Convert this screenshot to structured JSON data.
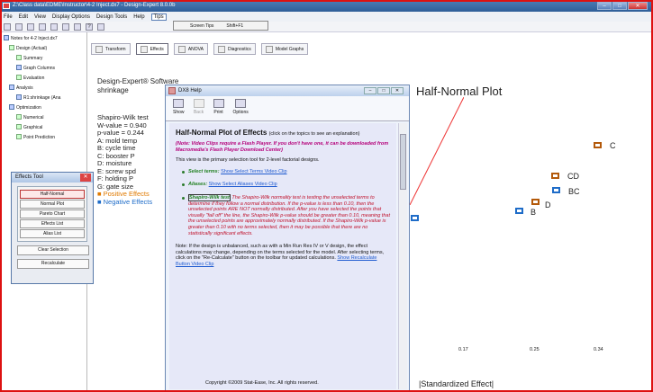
{
  "window": {
    "title": "Z:\\Class data\\EDME\\Instructor\\4-2 Inject.dx7 - Design-Expert 8.0.0b"
  },
  "menu": {
    "items": [
      "File",
      "Edit",
      "View",
      "Display Options",
      "Design Tools",
      "Help",
      "Tips"
    ],
    "tips_items": [
      "Screen Tips",
      "Shift+F1"
    ]
  },
  "tree": {
    "nodes": [
      "Notes for 4-2 Inject.dx7",
      "Design (Actual)",
      "Summary",
      "Graph Columns",
      "Evaluation",
      "Analysis",
      "R1:shrinkage (Ana",
      "Optimization",
      "Numerical",
      "Graphical",
      "Point Prediction"
    ]
  },
  "tabs": [
    "Transform",
    "Effects",
    "ANOVA",
    "Diagnostics",
    "Model Graphs"
  ],
  "content": {
    "software": "Design-Expert® Software",
    "response": "shrinkage",
    "stats": [
      "Shapiro-Wilk test",
      "W-value = 0.940",
      "p-value = 0.244",
      "A: mold temp",
      "B: cycle time",
      "C: booster P",
      "D: moisture",
      "E: screw spd",
      "F: holding P",
      "G: gate size"
    ],
    "positive": "Positive Effects",
    "negative": "Negative Effects",
    "plot_title": "Half-Normal Plot",
    "x_ticks": [
      "0.17",
      "0.25",
      "0.34"
    ],
    "x_title": "|Standardized Effect|",
    "point_labels": [
      "C",
      "CD",
      "BC",
      "D",
      "B"
    ]
  },
  "effects_tool": {
    "title": "Effects Tool",
    "buttons": [
      "Half-Normal",
      "Normal Plot",
      "Pareto Chart",
      "Effects List",
      "Alias List"
    ],
    "clear": "Clear Selection",
    "recalc": "Recalculate"
  },
  "help": {
    "title": "DX8 Help",
    "toolbar": [
      "Show",
      "Back",
      "Print",
      "Options"
    ],
    "heading": "Half-Normal Plot of Effects",
    "heading_note": "(click on the topics to see an explanation)",
    "note": "(Note: Video Clips require a Flash Player. If you don't have one, it can be downloaded from Macromedia's Flash Player Download Center)",
    "intro": "This view is the primary selection tool for 2-level factorial designs.",
    "li1_term": "Select terms:",
    "li1_link": "Show Select Terms Video Clip",
    "li2_term": "Aliases:",
    "li2_link": "Show Select Aliases Video Clip",
    "li3_term": "Shapiro-Wilk test",
    "li3_text": "The Shapiro-Wilk normality test is testing the unselected terms to determine if they follow a normal distribution. If the p-value is less than 0.10, then the unselected points ARE NOT normally distributed. After you have selected the points that visually \"fall off\" the line, the Shapiro-Wilk p-value should be greater than 0.10, meaning that the unselected points are approximately normally distributed. If the Shapiro-Wilk p-value is greater than 0.10 with no terms selected, then it may be possible that there are no statistically significant effects.",
    "note2": "Note: If the design is unbalanced, such as with a Min Run Res IV or V design, the effect calculations may change, depending on the terms selected for the model. After selecting terms, click on the \"Re-Calculate\" button on the toolbar for updated calculations.",
    "note2_link": "Show Recalculate Button Video Clip",
    "copyright": "Copyright ©2009  Stat-Ease, Inc. All rights reserved."
  }
}
